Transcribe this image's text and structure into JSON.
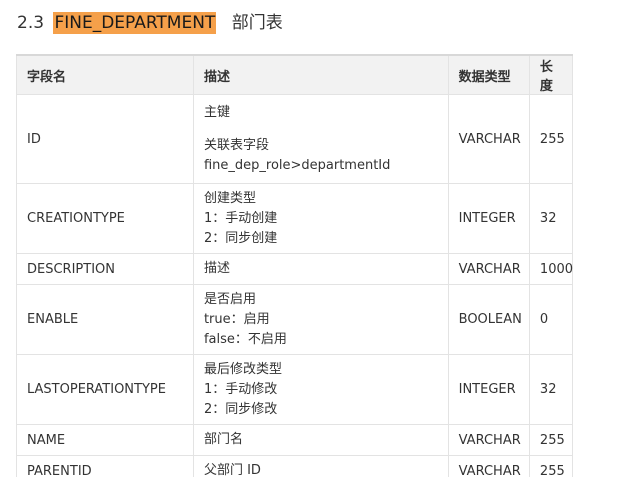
{
  "heading": {
    "number": "2.3",
    "table_name": "FINE_DEPARTMENT",
    "suffix": "部门表"
  },
  "table": {
    "headers": [
      "字段名",
      "描述",
      "数据类型",
      "长度"
    ],
    "rows": [
      {
        "name": "ID",
        "desc": [
          "主键",
          "",
          "关联表字段",
          "fine_dep_role>departmentId"
        ],
        "type": "VARCHAR",
        "length": "255"
      },
      {
        "name": "CREATIONTYPE",
        "desc": [
          "创建类型",
          "1：手动创建",
          "2：同步创建"
        ],
        "type": "INTEGER",
        "length": "32"
      },
      {
        "name": "DESCRIPTION",
        "desc": [
          "描述"
        ],
        "type": "VARCHAR",
        "length": "1000"
      },
      {
        "name": "ENABLE",
        "desc": [
          "是否启用",
          "true：启用",
          "false：不启用"
        ],
        "type": "BOOLEAN",
        "length": "0"
      },
      {
        "name": "LASTOPERATIONTYPE",
        "desc": [
          "最后修改类型",
          "1：手动修改",
          "2：同步修改"
        ],
        "type": "INTEGER",
        "length": "32"
      },
      {
        "name": "NAME",
        "desc": [
          "部门名"
        ],
        "type": "VARCHAR",
        "length": "255"
      },
      {
        "name": "PARENTID",
        "desc": [
          "父部门 ID"
        ],
        "type": "VARCHAR",
        "length": "255"
      }
    ]
  }
}
